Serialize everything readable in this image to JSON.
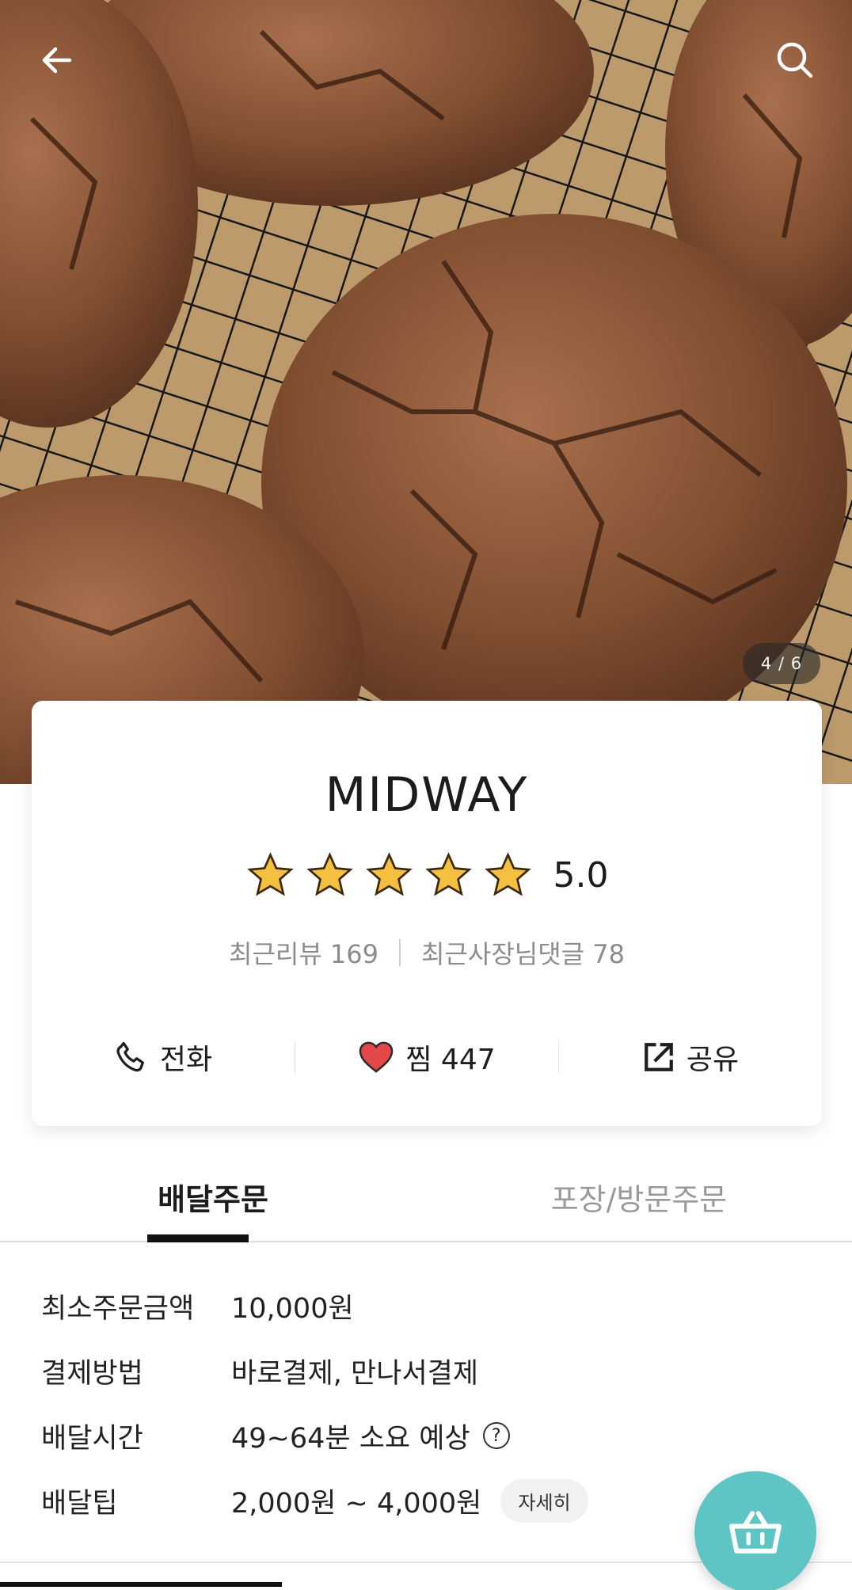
{
  "hero": {
    "photo_counter": "4 / 6",
    "back_icon": "arrow-left-icon",
    "search_icon": "search-icon",
    "photo_subject": "chocolate crinkle cookies on a wire cooling rack"
  },
  "store": {
    "name": "MIDWAY",
    "rating": "5.0",
    "stars_filled": 5,
    "stars_total": 5,
    "recent_reviews": "최근리뷰 169",
    "owner_replies": "최근사장님댓글 78"
  },
  "actions": {
    "call_label": "전화",
    "like_label": "찜 447",
    "share_label": "공유"
  },
  "tabs": [
    {
      "label": "배달주문",
      "active": true
    },
    {
      "label": "포장/방문주문",
      "active": false
    }
  ],
  "info": {
    "rows": [
      {
        "label": "최소주문금액",
        "value": "10,000원"
      },
      {
        "label": "결제방법",
        "value": "바로결제, 만나서결제"
      },
      {
        "label": "배달시간",
        "value": "49~64분 소요 예상"
      },
      {
        "label": "배달팁",
        "value": "2,000원 ~ 4,000원"
      }
    ],
    "detail_button": "자세히",
    "help_icon_glyph": "?"
  },
  "colors": {
    "accent_fab": "#5ec4c4",
    "star": "#f5bf3f",
    "heart": "#e54848"
  }
}
